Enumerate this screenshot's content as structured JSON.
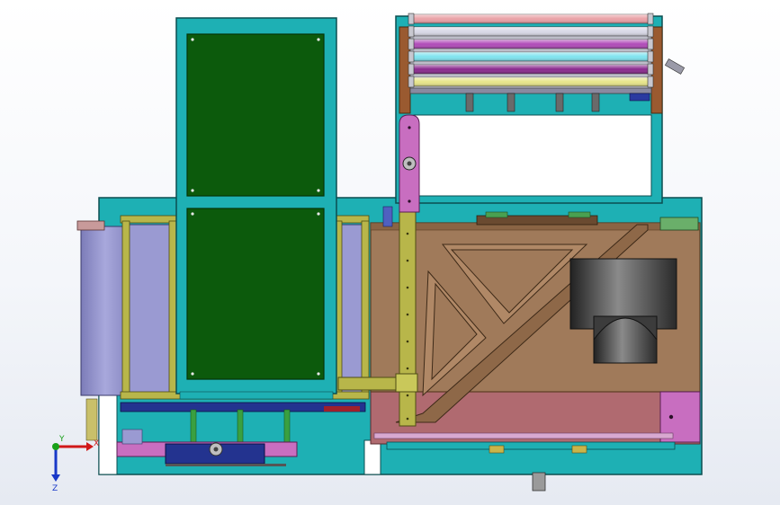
{
  "view": {
    "background_top": "#ffffff",
    "background_bottom": "#e6eaf2"
  },
  "colors": {
    "frame": "#1eb0b4",
    "frame_edge": "#0c4e50",
    "pcb": "#0c5a0c",
    "pcb_edge": "#063406",
    "wood": "#a07a5a",
    "wood_dark": "#7a5638",
    "pink_base": "#b06a70",
    "magenta": "#c86ec0",
    "lavender": "#9a9ad2",
    "olive": "#b8b64a",
    "navy": "#23338f",
    "roller_pink": "#e9a0a6",
    "roller_cyan": "#7fe3ef",
    "roller_yellow": "#e7e58a",
    "roller_violet": "#9a3aa4",
    "cylinder": "#4a4a4a"
  },
  "axes": {
    "x_label": "X",
    "y_label": "Y",
    "z_label": "Z",
    "x_color": "#d01818",
    "y_color": "#18a018",
    "z_color": "#1838c8"
  },
  "rollers": [
    {
      "name": "roller-pink",
      "color": "#e9a0a6"
    },
    {
      "name": "roller-light",
      "color": "#d8d8e6"
    },
    {
      "name": "roller-violet",
      "color": "#b04ab8"
    },
    {
      "name": "roller-cyan",
      "color": "#7fe3ef"
    },
    {
      "name": "roller-purple",
      "color": "#8a2a8e"
    },
    {
      "name": "roller-yellow",
      "color": "#e7e58a"
    }
  ]
}
